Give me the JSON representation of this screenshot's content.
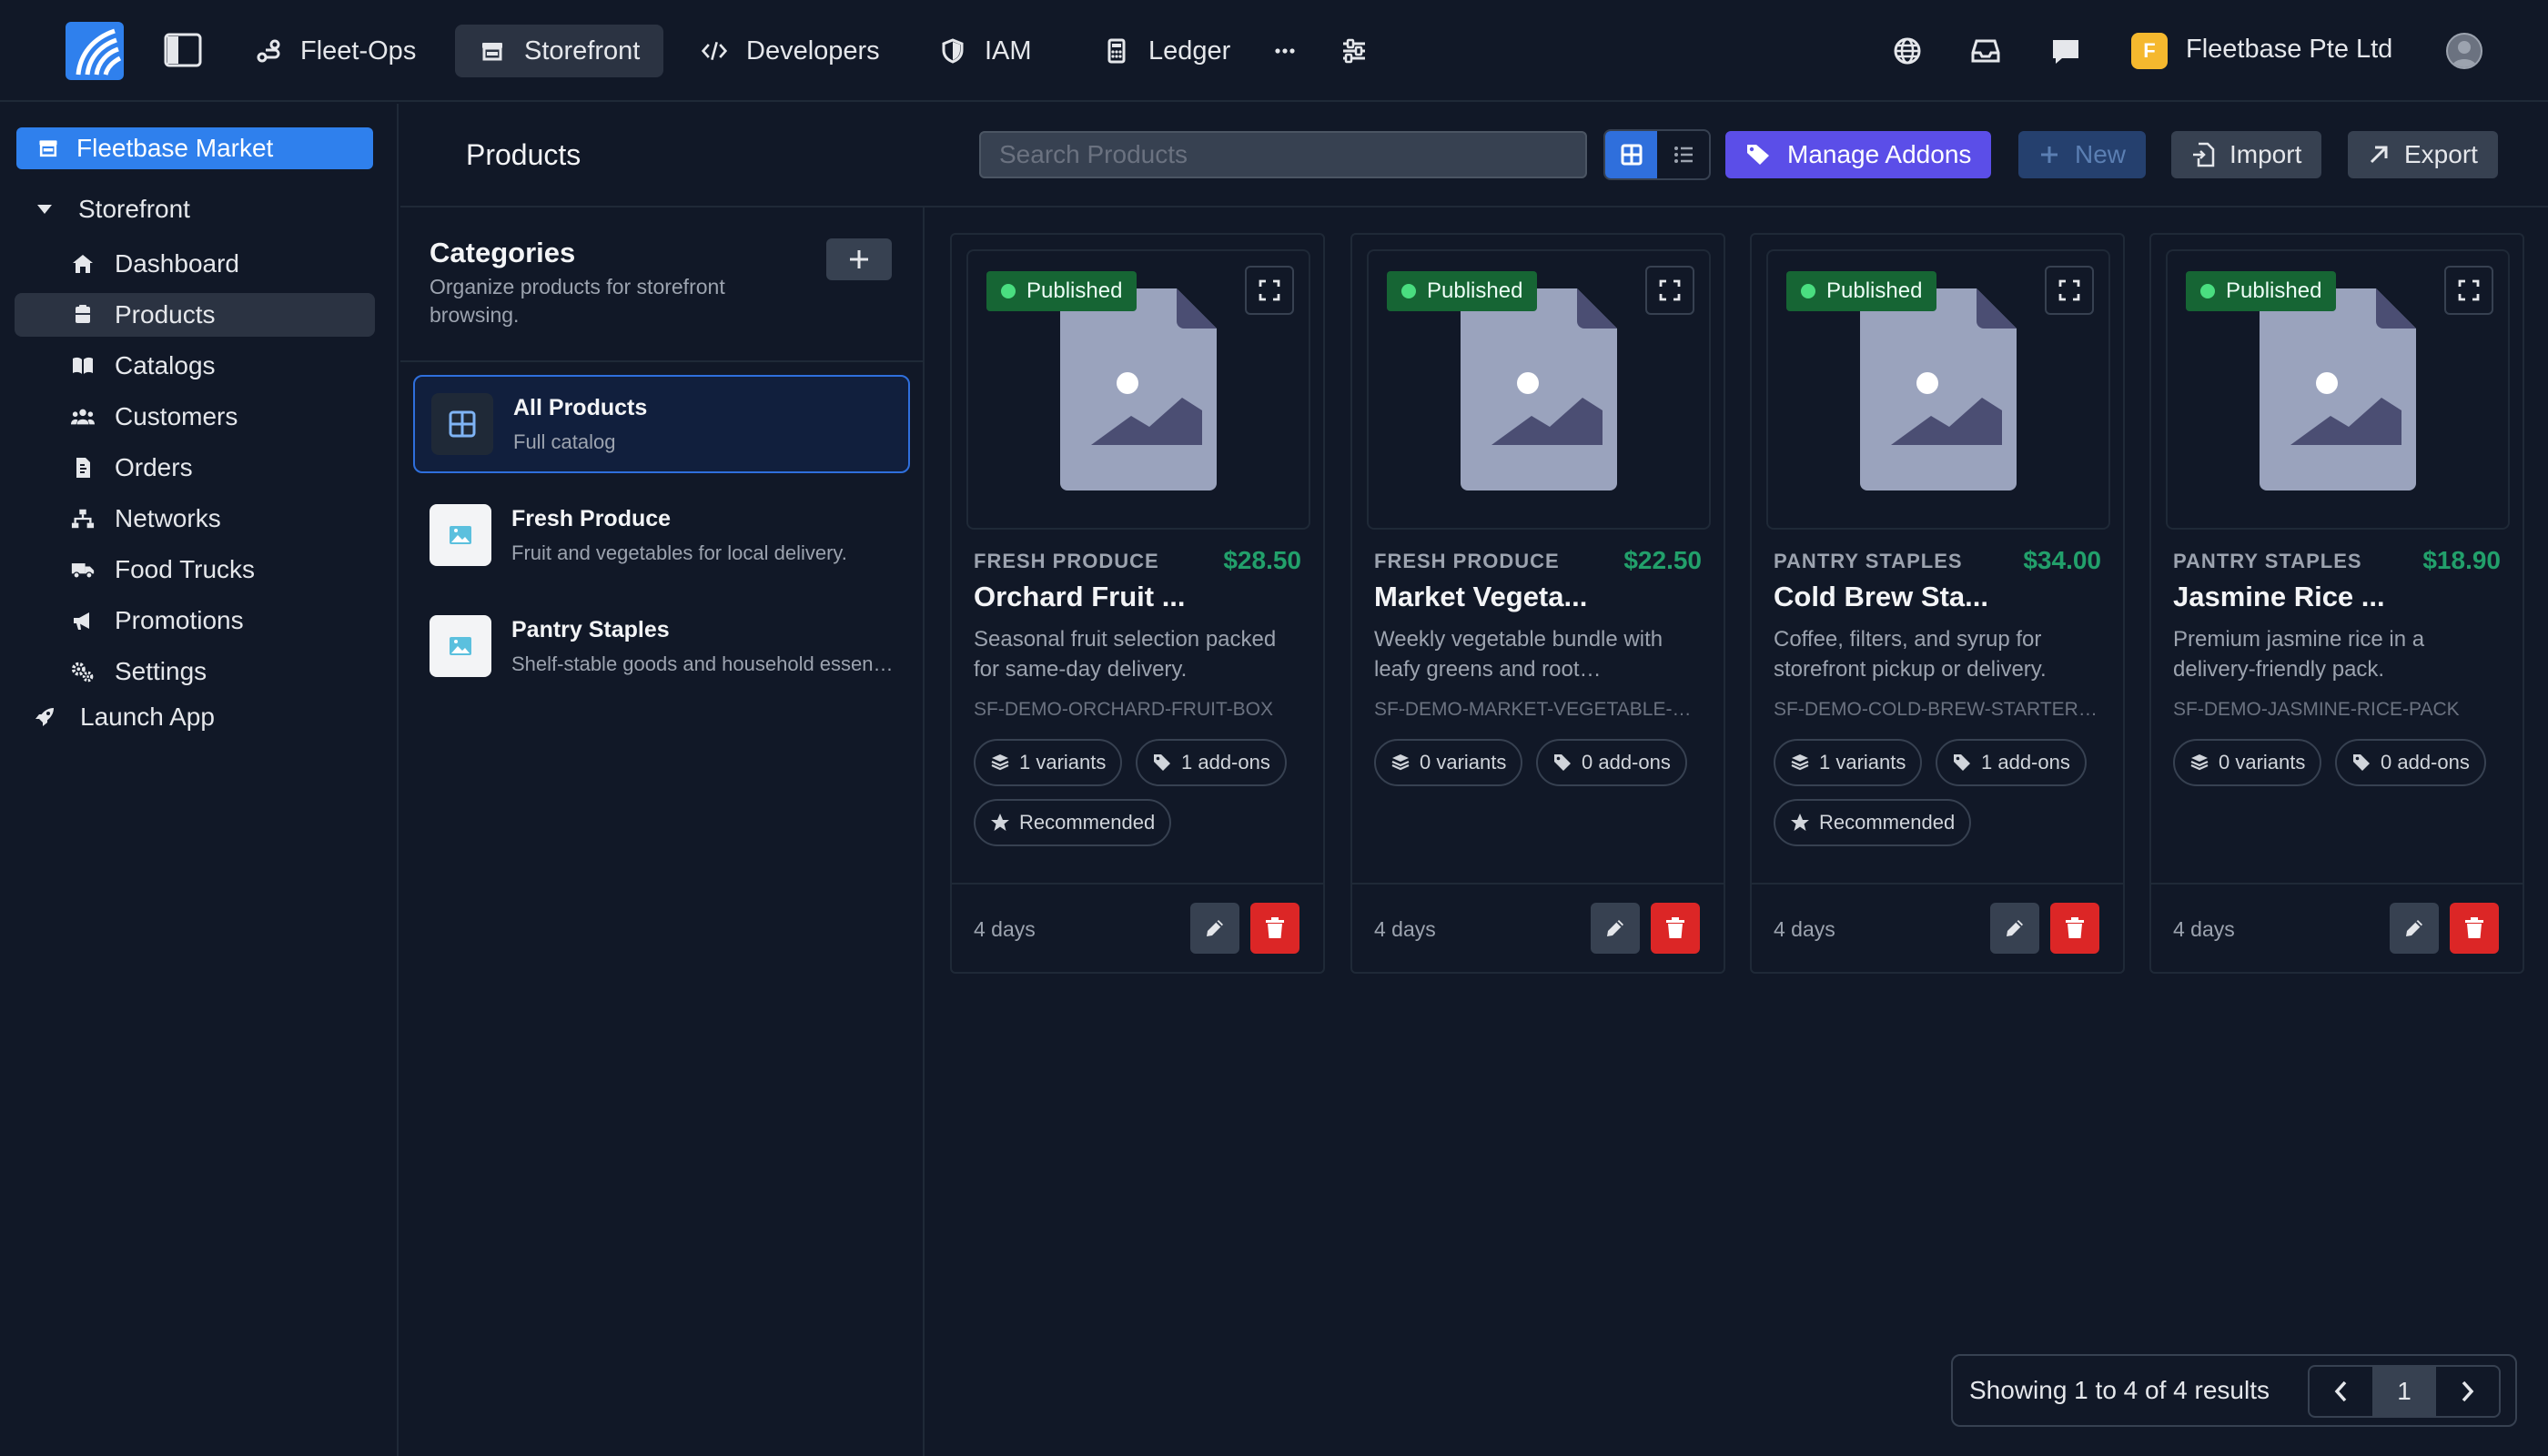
{
  "topnav": {
    "items": [
      {
        "label": "Fleet-Ops",
        "icon": "route-icon"
      },
      {
        "label": "Storefront",
        "icon": "store-icon",
        "active": true
      },
      {
        "label": "Developers",
        "icon": "code-icon"
      },
      {
        "label": "IAM",
        "icon": "shield-icon"
      },
      {
        "label": "Ledger",
        "icon": "calculator-icon"
      }
    ],
    "org_initial": "F",
    "org_name": "Fleetbase Pte Ltd"
  },
  "sidebar": {
    "store_name": "Fleetbase Market",
    "section": "Storefront",
    "items": [
      {
        "label": "Dashboard",
        "icon": "home-icon"
      },
      {
        "label": "Products",
        "icon": "box-icon",
        "active": true
      },
      {
        "label": "Catalogs",
        "icon": "book-icon"
      },
      {
        "label": "Customers",
        "icon": "users-icon"
      },
      {
        "label": "Orders",
        "icon": "receipt-icon"
      },
      {
        "label": "Networks",
        "icon": "network-icon"
      },
      {
        "label": "Food Trucks",
        "icon": "truck-icon"
      },
      {
        "label": "Promotions",
        "icon": "megaphone-icon"
      },
      {
        "label": "Settings",
        "icon": "gears-icon"
      }
    ],
    "launch_label": "Launch App"
  },
  "header": {
    "title": "Products",
    "search_placeholder": "Search Products",
    "manage_addons_label": "Manage Addons",
    "new_label": "New",
    "import_label": "Import",
    "export_label": "Export"
  },
  "categories": {
    "title": "Categories",
    "subtitle": "Organize products for storefront browsing.",
    "items": [
      {
        "name": "All Products",
        "description": "Full catalog",
        "active": true
      },
      {
        "name": "Fresh Produce",
        "description": "Fruit and vegetables for local delivery."
      },
      {
        "name": "Pantry Staples",
        "description": "Shelf-stable goods and household essentials."
      }
    ]
  },
  "products": [
    {
      "status": "Published",
      "category": "FRESH PRODUCE",
      "price": "$28.50",
      "name": "Orchard Fruit ...",
      "description": "Seasonal fruit selection packed for same-day delivery.",
      "sku": "SF-DEMO-ORCHARD-FRUIT-BOX",
      "variants": "1 variants",
      "addons": "1 add-ons",
      "recommended": "Recommended",
      "age": "4 days"
    },
    {
      "status": "Published",
      "category": "FRESH PRODUCE",
      "price": "$22.50",
      "name": "Market Vegeta...",
      "description": "Weekly vegetable bundle with leafy greens and root…",
      "sku": "SF-DEMO-MARKET-VEGETABLE-BUNDLE",
      "variants": "0 variants",
      "addons": "0 add-ons",
      "recommended": "",
      "age": "4 days"
    },
    {
      "status": "Published",
      "category": "PANTRY STAPLES",
      "price": "$34.00",
      "name": "Cold Brew Sta...",
      "description": "Coffee, filters, and syrup for storefront pickup or delivery.",
      "sku": "SF-DEMO-COLD-BREW-STARTER-KIT",
      "variants": "1 variants",
      "addons": "1 add-ons",
      "recommended": "Recommended",
      "age": "4 days"
    },
    {
      "status": "Published",
      "category": "PANTRY STAPLES",
      "price": "$18.90",
      "name": "Jasmine Rice ...",
      "description": "Premium jasmine rice in a delivery-friendly pack.",
      "sku": "SF-DEMO-JASMINE-RICE-PACK",
      "variants": "0 variants",
      "addons": "0 add-ons",
      "recommended": "",
      "age": "4 days"
    }
  ],
  "pagination": {
    "summary": "Showing 1 to 4 of 4 results",
    "current_page": "1"
  },
  "colors": {
    "background": "#111827",
    "accent": "#2f80ed",
    "addons_button": "#5b4ee8",
    "published": "#166534",
    "price": "#22a06b",
    "delete": "#dc2626"
  }
}
